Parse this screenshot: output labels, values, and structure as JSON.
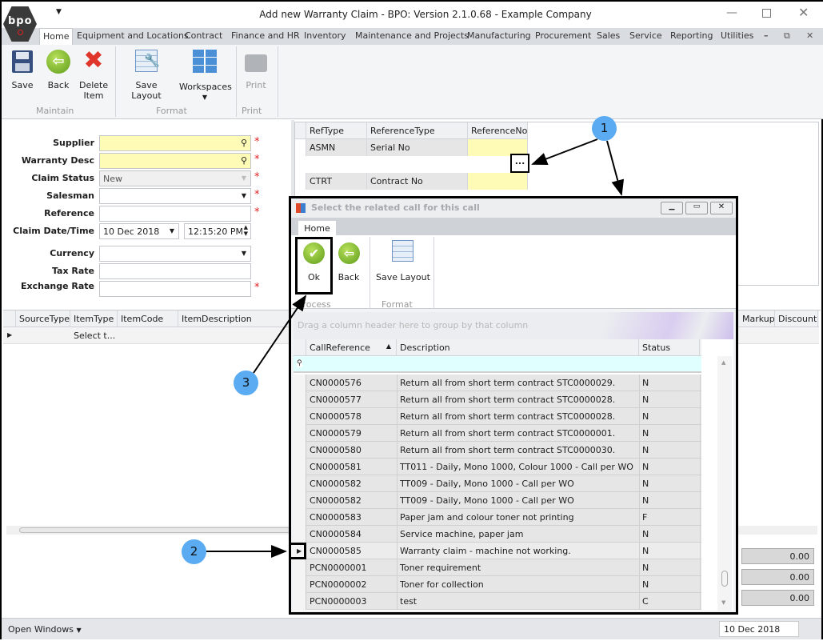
{
  "window": {
    "title": "Add new Warranty Claim - BPO: Version 2.1.0.68 - Example Company",
    "logo_text": "bpo"
  },
  "menu_tabs": [
    "Home",
    "Equipment and Locations",
    "Contract",
    "Finance and HR",
    "Inventory",
    "Maintenance and Projects",
    "Manufacturing",
    "Procurement",
    "Sales",
    "Service",
    "Reporting",
    "Utilities"
  ],
  "ribbon": {
    "save": "Save",
    "back": "Back",
    "delete": "Delete Item",
    "save_layout": "Save Layout",
    "workspaces": "Workspaces",
    "print": "Print",
    "groups": {
      "maintain": "Maintain",
      "format": "Format",
      "print": "Print"
    }
  },
  "form": {
    "supplier_label": "Supplier",
    "warranty_desc_label": "Warranty Desc",
    "claim_status_label": "Claim Status",
    "claim_status_value": "New",
    "salesman_label": "Salesman",
    "reference_label": "Reference",
    "claim_datetime_label": "Claim Date/Time",
    "claim_date": "10 Dec 2018",
    "claim_time": "12:15:20 PM",
    "currency_label": "Currency",
    "tax_rate_label": "Tax Rate",
    "exchange_rate_label": "Exchange Rate",
    "required_mark": "*"
  },
  "ref_grid": {
    "headers": [
      "RefType",
      "ReferenceType",
      "ReferenceNo"
    ],
    "rows": [
      [
        "ASMN",
        "Serial No",
        ""
      ],
      [
        "CTRT",
        "Contract No",
        ""
      ]
    ],
    "ellipsis": "..."
  },
  "items_grid": {
    "headers": [
      "SourceType",
      "ItemType",
      "ItemCode",
      "ItemDescription",
      "Markup",
      "Discount"
    ],
    "first_row_itemtype": "Select t..."
  },
  "totals": [
    "0.00",
    "0.00",
    "0.00"
  ],
  "status_bar": {
    "open_windows": "Open Windows",
    "date": "10 Dec 2018"
  },
  "dialog": {
    "title": "Select the related call for this call",
    "tab": "Home",
    "ok": "Ok",
    "back": "Back",
    "save_layout": "Save Layout",
    "groups": {
      "process": "Process",
      "format": "Format"
    },
    "group_panel_hint": "Drag a column header here to group by that column",
    "headers": [
      "CallReference",
      "Description",
      "Status"
    ],
    "rows": [
      [
        "CN0000576",
        "Return all from short term contract STC0000029.",
        "N"
      ],
      [
        "CN0000577",
        "Return all from short term contract STC0000028.",
        "N"
      ],
      [
        "CN0000578",
        "Return all from short term contract STC0000028.",
        "N"
      ],
      [
        "CN0000579",
        "Return all from short term contract STC0000001.",
        "N"
      ],
      [
        "CN0000580",
        "Return all from short term contract STC0000030.",
        "N"
      ],
      [
        "CN0000581",
        "TT011 - Daily, Mono 1000, Colour 1000 - Call per WO",
        "N"
      ],
      [
        "CN0000582",
        "TT009 - Daily, Mono 1000 - Call per WO",
        "N"
      ],
      [
        "CN0000582",
        "TT009 - Daily, Mono 1000 - Call per WO",
        "N"
      ],
      [
        "CN0000583",
        "Paper jam and colour toner not printing",
        "F"
      ],
      [
        "CN0000584",
        "Service machine, paper jam",
        "N"
      ],
      [
        "CN0000585",
        "Warranty claim - machine not working.",
        "N"
      ],
      [
        "PCN0000001",
        "Toner requirement",
        "N"
      ],
      [
        "PCN0000002",
        "Toner for collection",
        "N"
      ],
      [
        "PCN0000003",
        "test",
        "C"
      ]
    ],
    "selected_index": 10
  },
  "annotations": [
    "1",
    "2",
    "3"
  ],
  "colors": {
    "required": "#e02020",
    "lookup_bg": "#fdfbb6",
    "filter_row": "#e0ffff",
    "callout": "#5aabf2"
  }
}
